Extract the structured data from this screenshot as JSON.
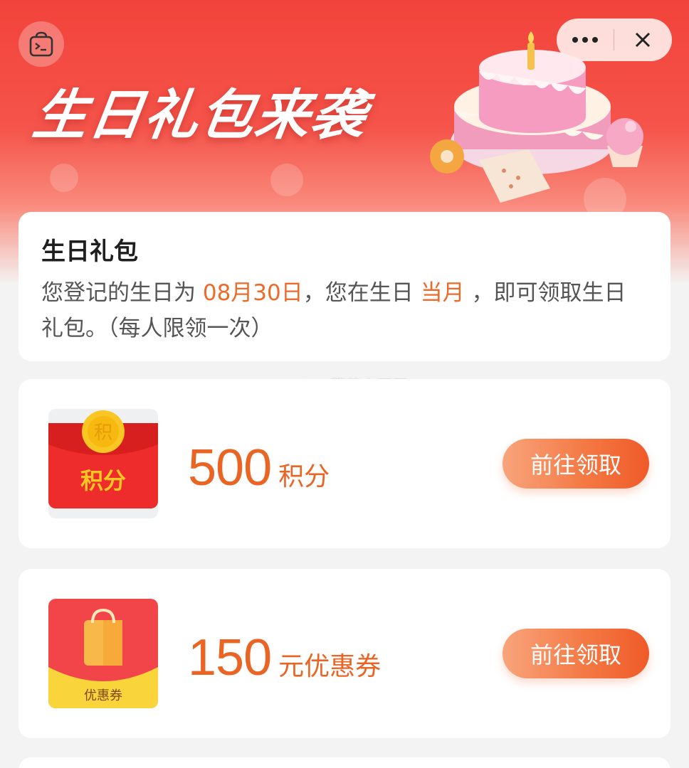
{
  "banner": {
    "title": "生日礼包来袭"
  },
  "capsule": {
    "more_icon": "more-dots-icon",
    "close_icon": "close-icon"
  },
  "info": {
    "title": "生日礼包",
    "text_prefix": "您登记的生日为 ",
    "birthday": "08月30日",
    "text_middle": "，您在生日 ",
    "period": "当月",
    "text_suffix": " ，即可领取生日礼包。（每人限领一次）"
  },
  "watermark": "@蘑菇小牙牙",
  "gifts": [
    {
      "amount": "500",
      "unit": "积分",
      "icon_label": "积分",
      "coin_label": "积",
      "button": "前往领取",
      "icon": "red-envelope-icon"
    },
    {
      "amount": "150",
      "unit": "元优惠券",
      "icon_label": "优惠券",
      "button": "前往领取",
      "icon": "shopping-bag-coupon-icon"
    }
  ],
  "colors": {
    "accent": "#ea6424",
    "banner_red": "#f2433b",
    "button_start": "#f8a47c",
    "button_end": "#ef5a28"
  }
}
